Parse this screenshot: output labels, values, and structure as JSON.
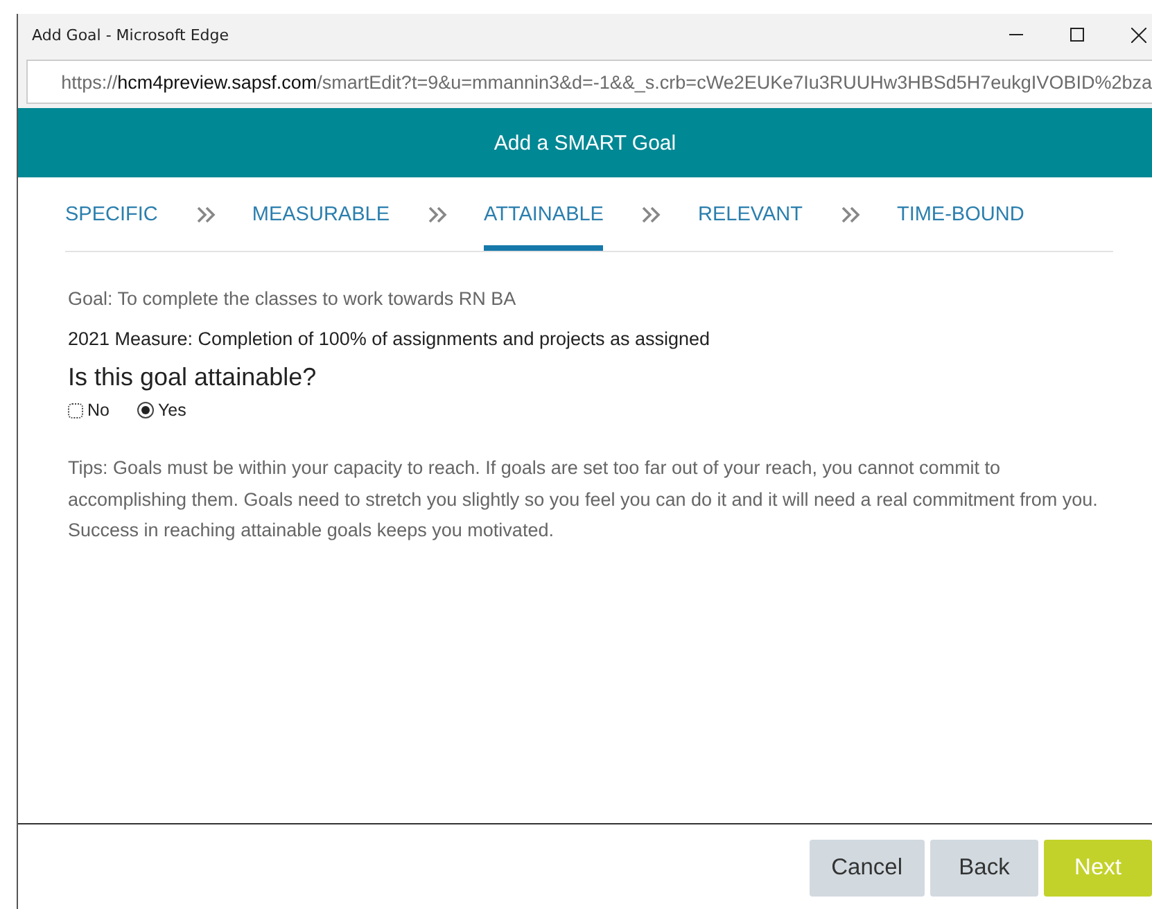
{
  "window": {
    "title": "Add Goal - Microsoft Edge"
  },
  "address_bar": {
    "scheme": "https://",
    "host": "hcm4preview.sapsf.com",
    "path": "/smartEdit?t=9&u=mmannin3&d=-1&&_s.crb=cWe2EUKe7Iu3RUUHw3HBSd5H7eukgIVOBID%2bza"
  },
  "header": {
    "title": "Add a SMART Goal"
  },
  "steps": [
    {
      "label": "SPECIFIC",
      "selected": false
    },
    {
      "label": "MEASURABLE",
      "selected": false
    },
    {
      "label": "ATTAINABLE",
      "selected": true
    },
    {
      "label": "RELEVANT",
      "selected": false
    },
    {
      "label": "TIME-BOUND",
      "selected": false
    }
  ],
  "goal": "Goal: To complete the classes to work towards RN BA",
  "measure": "2021 Measure: Completion of 100% of assignments and projects as assigned",
  "question": "Is this goal attainable?",
  "options": [
    {
      "label": "No",
      "selected": false
    },
    {
      "label": "Yes",
      "selected": true
    }
  ],
  "tips": "Tips: Goals must be within your capacity to reach. If goals are set too far out of your reach, you cannot commit to accomplishing them. Goals need to stretch you slightly so you feel you can do it and it will need a real commitment from you. Success in reaching attainable goals keeps you motivated.",
  "buttons": [
    {
      "label": "Cancel",
      "kind": "secondary"
    },
    {
      "label": "Back",
      "kind": "secondary"
    },
    {
      "label": "Next",
      "kind": "primary"
    }
  ]
}
